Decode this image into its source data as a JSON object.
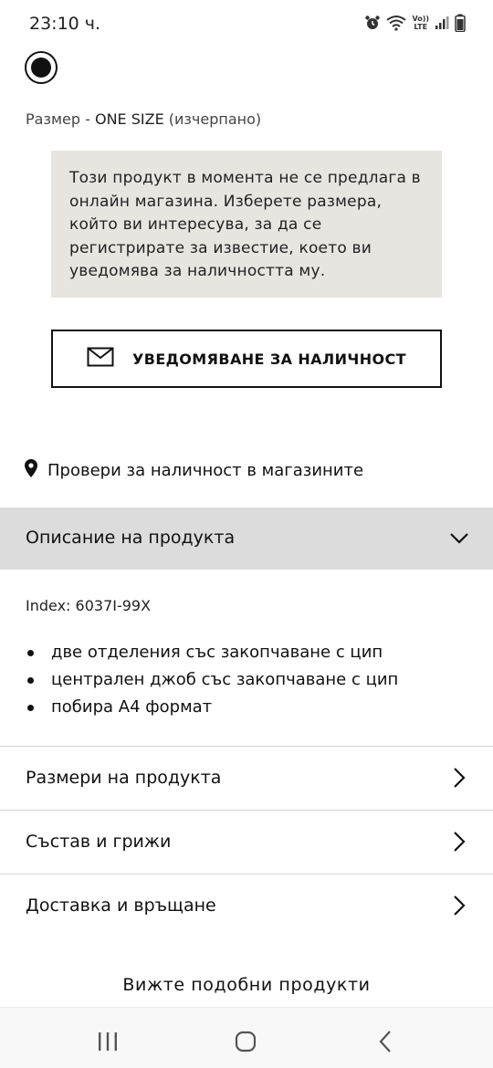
{
  "status_bar": {
    "time": "23:10 ч.",
    "icons": [
      "alarm-icon",
      "wifi-icon",
      "volte-icon",
      "signal-icon",
      "battery-icon"
    ],
    "volte_line1": "Vo))",
    "volte_line2": "LTE"
  },
  "product": {
    "swatch_color": "#111111",
    "size_label": "Размер  -  ",
    "size_value": "ONE SIZE",
    "size_status": " (изчерпано)"
  },
  "info_box": {
    "text": "Този продукт в момента не се предлага в онлайн магазина. Изберете размера, който ви интересува, за да се регистрирате за известие, което ви уведомява за наличността му."
  },
  "notify_button": {
    "icon": "envelope-icon",
    "label": "УВЕДОМЯВАНЕ ЗА НАЛИЧНОСТ"
  },
  "store_check": {
    "icon": "location-pin-icon",
    "label": "Провери за наличност в магазините"
  },
  "description": {
    "title": "Описание на продукта",
    "index": "Index: 6037I-99X",
    "bullets": [
      "две отделения със закопчаване с цип",
      "централен джоб със закопчаване с цип",
      "побира А4 формат"
    ]
  },
  "accordion": [
    {
      "label": "Размери на продукта"
    },
    {
      "label": "Състав и грижи"
    },
    {
      "label": "Доставка и връщане"
    }
  ],
  "similar_products": {
    "title": "Вижте подобни продукти"
  },
  "nav_bar": {
    "buttons": [
      "recent-apps-icon",
      "home-icon",
      "back-icon"
    ]
  }
}
